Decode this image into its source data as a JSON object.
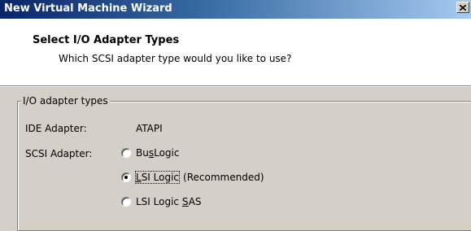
{
  "window": {
    "title": "New Virtual Machine Wizard",
    "close_glyph": "×"
  },
  "header": {
    "heading": "Select I/O Adapter Types",
    "subheading": "Which SCSI adapter type would you like to use?"
  },
  "group": {
    "legend": "I/O adapter types",
    "ide": {
      "label": "IDE Adapter:",
      "value": "ATAPI"
    },
    "scsi": {
      "label": "SCSI Adapter:",
      "options": [
        {
          "pre": "Bu",
          "ul": "s",
          "post": "Logic",
          "suffix": "",
          "checked": false
        },
        {
          "pre": "",
          "ul": "L",
          "post": "SI Logic",
          "suffix": "(Recommended)",
          "checked": true
        },
        {
          "pre": "LSI Logic ",
          "ul": "S",
          "post": "AS",
          "suffix": "",
          "checked": false
        }
      ]
    }
  },
  "colors": {
    "window_bg": "#d4d0c8",
    "titlebar_start": "#0a246a",
    "titlebar_end": "#a6caf0",
    "header_bg": "#ffffff"
  }
}
